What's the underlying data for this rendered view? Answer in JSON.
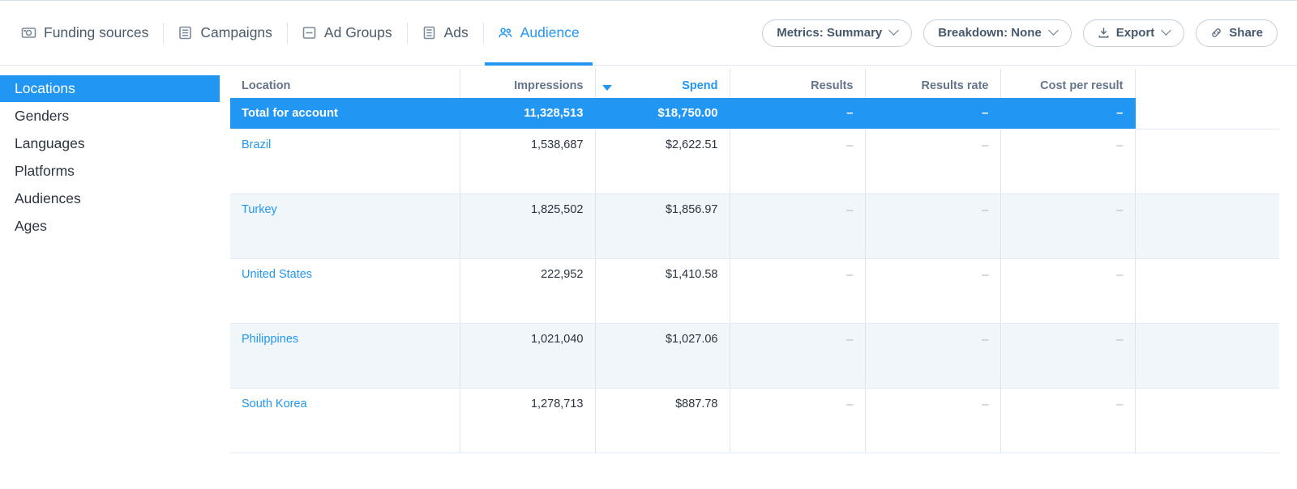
{
  "tabs": [
    {
      "label": "Funding sources",
      "icon": "funding-sources-icon",
      "active": false
    },
    {
      "label": "Campaigns",
      "icon": "campaigns-icon",
      "active": false
    },
    {
      "label": "Ad Groups",
      "icon": "ad-groups-icon",
      "active": false
    },
    {
      "label": "Ads",
      "icon": "ads-icon",
      "active": false
    },
    {
      "label": "Audience",
      "icon": "audience-icon",
      "active": true
    }
  ],
  "toolbar": {
    "metrics_label": "Metrics: Summary",
    "breakdown_label": "Breakdown: None",
    "export_label": "Export",
    "share_label": "Share"
  },
  "sidebar": {
    "items": [
      {
        "label": "Locations",
        "active": true
      },
      {
        "label": "Genders",
        "active": false
      },
      {
        "label": "Languages",
        "active": false
      },
      {
        "label": "Platforms",
        "active": false
      },
      {
        "label": "Audiences",
        "active": false
      },
      {
        "label": "Ages",
        "active": false
      }
    ]
  },
  "table": {
    "columns": [
      {
        "label": "Location",
        "align": "left",
        "sorted": false
      },
      {
        "label": "Impressions",
        "align": "right",
        "sorted": false
      },
      {
        "label": "Spend",
        "align": "right",
        "sorted": true
      },
      {
        "label": "Results",
        "align": "right",
        "sorted": false
      },
      {
        "label": "Results rate",
        "align": "right",
        "sorted": false
      },
      {
        "label": "Cost per result",
        "align": "right",
        "sorted": false
      },
      {
        "label": "",
        "align": "right",
        "sorted": false
      }
    ],
    "sort": {
      "column": "Spend",
      "direction": "desc"
    },
    "total_row": {
      "label": "Total for account",
      "impressions": "11,328,513",
      "spend": "$18,750.00",
      "results": "–",
      "results_rate": "–",
      "cost_per_result": "–"
    },
    "rows": [
      {
        "location": "Brazil",
        "impressions": "1,538,687",
        "spend": "$2,622.51",
        "results": "–",
        "results_rate": "–",
        "cost_per_result": "–"
      },
      {
        "location": "Turkey",
        "impressions": "1,825,502",
        "spend": "$1,856.97",
        "results": "–",
        "results_rate": "–",
        "cost_per_result": "–"
      },
      {
        "location": "United States",
        "impressions": "222,952",
        "spend": "$1,410.58",
        "results": "–",
        "results_rate": "–",
        "cost_per_result": "–"
      },
      {
        "location": "Philippines",
        "impressions": "1,021,040",
        "spend": "$1,027.06",
        "results": "–",
        "results_rate": "–",
        "cost_per_result": "–"
      },
      {
        "location": "South Korea",
        "impressions": "1,278,713",
        "spend": "$887.78",
        "results": "–",
        "results_rate": "–",
        "cost_per_result": "–"
      }
    ]
  },
  "colors": {
    "accent": "#2196f3",
    "link": "#2196f3",
    "header_text": "#64748b",
    "alt_row": "#f1f6fa",
    "border": "#dde4ec"
  }
}
